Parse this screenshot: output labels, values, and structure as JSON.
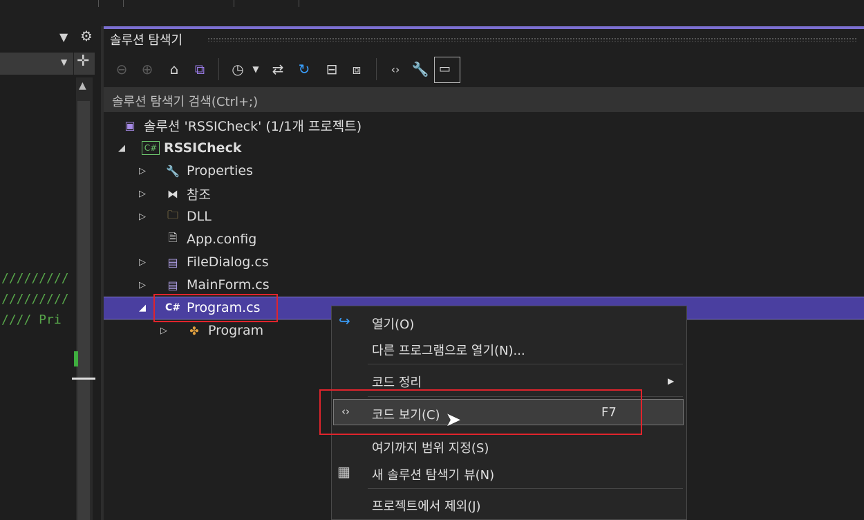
{
  "solution_explorer": {
    "title": "솔루션 탐색기",
    "search_placeholder": "솔루션 탐색기 검색(Ctrl+;)",
    "toolbar_icons": [
      "back-icon",
      "forward-icon",
      "home-icon",
      "vs-solution-icon",
      "history-icon",
      "dropdown-icon",
      "sync-icon",
      "refresh-icon",
      "collapse-all-icon",
      "show-all-files-icon",
      "code-view-icon",
      "properties-icon",
      "preview-icon"
    ]
  },
  "code_lines": [
    "/////////",
    "/////////",
    "//// Pri"
  ],
  "tree": {
    "solution": "솔루션 'RSSICheck' (1/1개 프로젝트)",
    "project": "RSSICheck",
    "items": [
      {
        "label": "Properties"
      },
      {
        "label": "참조"
      },
      {
        "label": "DLL"
      },
      {
        "label": "App.config"
      },
      {
        "label": "FileDialog.cs"
      },
      {
        "label": "MainForm.cs"
      },
      {
        "label": "Program.cs",
        "selected": true
      },
      {
        "label": "Program"
      }
    ]
  },
  "context_menu": {
    "items": [
      {
        "label": "열기(O)"
      },
      {
        "label": "다른 프로그램으로 열기(N)..."
      },
      {
        "label": "코드 정리",
        "submenu": true
      },
      {
        "label": "코드 보기(C)",
        "shortcut": "F7",
        "highlighted": true
      },
      {
        "label": "여기까지 범위 지정(S)"
      },
      {
        "label": "새 솔루션 탐색기 뷰(N)"
      },
      {
        "label": "프로젝트에서 제외(J)"
      }
    ]
  },
  "colors": {
    "selection": "#4a3fa0",
    "accent": "#7b6fd1",
    "annotation_red": "#e0242c"
  }
}
